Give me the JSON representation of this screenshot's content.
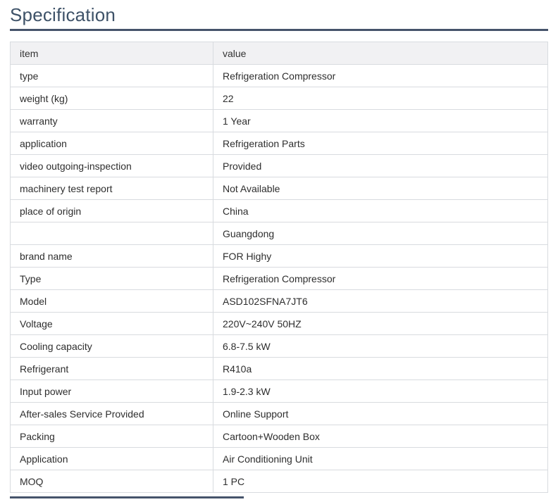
{
  "page": {
    "title": "Specification"
  },
  "colors": {
    "title_text": "#3e5268",
    "accent_divider": "#46546b",
    "table_border": "#d8dbdf",
    "header_row_bg": "#f1f1f3",
    "cell_text": "#2e2e2e"
  },
  "table": {
    "headers": [
      "item",
      "value"
    ],
    "rows": [
      {
        "item": "type",
        "value": "Refrigeration Compressor"
      },
      {
        "item": "weight (kg)",
        "value": "22"
      },
      {
        "item": "warranty",
        "value": "1 Year"
      },
      {
        "item": "application",
        "value": "Refrigeration Parts"
      },
      {
        "item": "video outgoing-inspection",
        "value": "Provided"
      },
      {
        "item": "machinery test report",
        "value": "Not Available"
      },
      {
        "item": "place of origin",
        "value": "China"
      },
      {
        "item": "",
        "value": "Guangdong"
      },
      {
        "item": "brand name",
        "value": "FOR Highy"
      },
      {
        "item": "Type",
        "value": "Refrigeration Compressor"
      },
      {
        "item": "Model",
        "value": "ASD102SFNA7JT6"
      },
      {
        "item": "Voltage",
        "value": "220V~240V 50HZ"
      },
      {
        "item": "Cooling capacity",
        "value": "6.8-7.5 kW"
      },
      {
        "item": "Refrigerant",
        "value": "R410a"
      },
      {
        "item": "Input power",
        "value": "1.9-2.3 kW"
      },
      {
        "item": "After-sales Service Provided",
        "value": "Online Support"
      },
      {
        "item": "Packing",
        "value": "Cartoon+Wooden Box"
      },
      {
        "item": "Application",
        "value": "Air Conditioning Unit"
      },
      {
        "item": "MOQ",
        "value": "1 PC"
      }
    ]
  }
}
